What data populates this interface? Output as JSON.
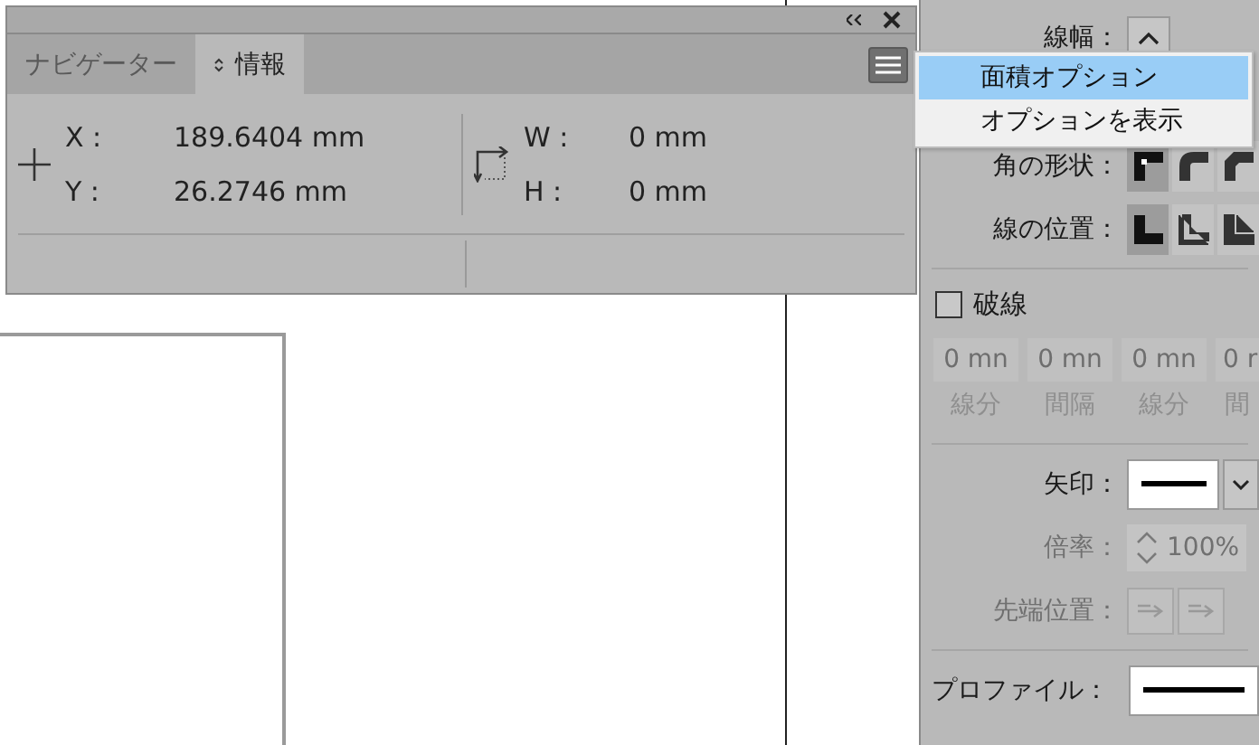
{
  "info_panel": {
    "tabs": [
      {
        "label": "ナビゲーター",
        "selected": false
      },
      {
        "label": "情報",
        "selected": true
      }
    ],
    "position": {
      "x_label": "X :",
      "x_value": "189.6404 mm",
      "y_label": "Y :",
      "y_value": "26.2746 mm"
    },
    "size": {
      "w_label": "W :",
      "w_value": "0 mm",
      "h_label": "H :",
      "h_value": "0 mm"
    }
  },
  "context_menu": [
    {
      "label": "面積オプション",
      "selected": true
    },
    {
      "label": "オプションを表示",
      "selected": false
    }
  ],
  "stroke_panel": {
    "weight_label": "線幅：",
    "corner_label": "角の形状：",
    "corners": [
      {
        "kind": "miter",
        "selected": true
      },
      {
        "kind": "round",
        "selected": false
      },
      {
        "kind": "bevel",
        "selected": false
      }
    ],
    "align_label": "線の位置：",
    "aligns": [
      {
        "kind": "center",
        "selected": true
      },
      {
        "kind": "inside",
        "selected": false
      },
      {
        "kind": "outside",
        "selected": false
      }
    ],
    "dashed": {
      "label": "破線",
      "checked": false
    },
    "dash_disabled": true,
    "dash_fields": [
      {
        "value": "0 mn",
        "label": "線分"
      },
      {
        "value": "0 mn",
        "label": "間隔"
      },
      {
        "value": "0 mn",
        "label": "線分"
      },
      {
        "value": "0 r",
        "label": "間"
      }
    ],
    "arrow_label": "矢印：",
    "scale": {
      "label": "倍率：",
      "value": "100%",
      "disabled": true
    },
    "tip": {
      "label": "先端位置：",
      "disabled": true
    },
    "profile_label": "プロファイル："
  }
}
